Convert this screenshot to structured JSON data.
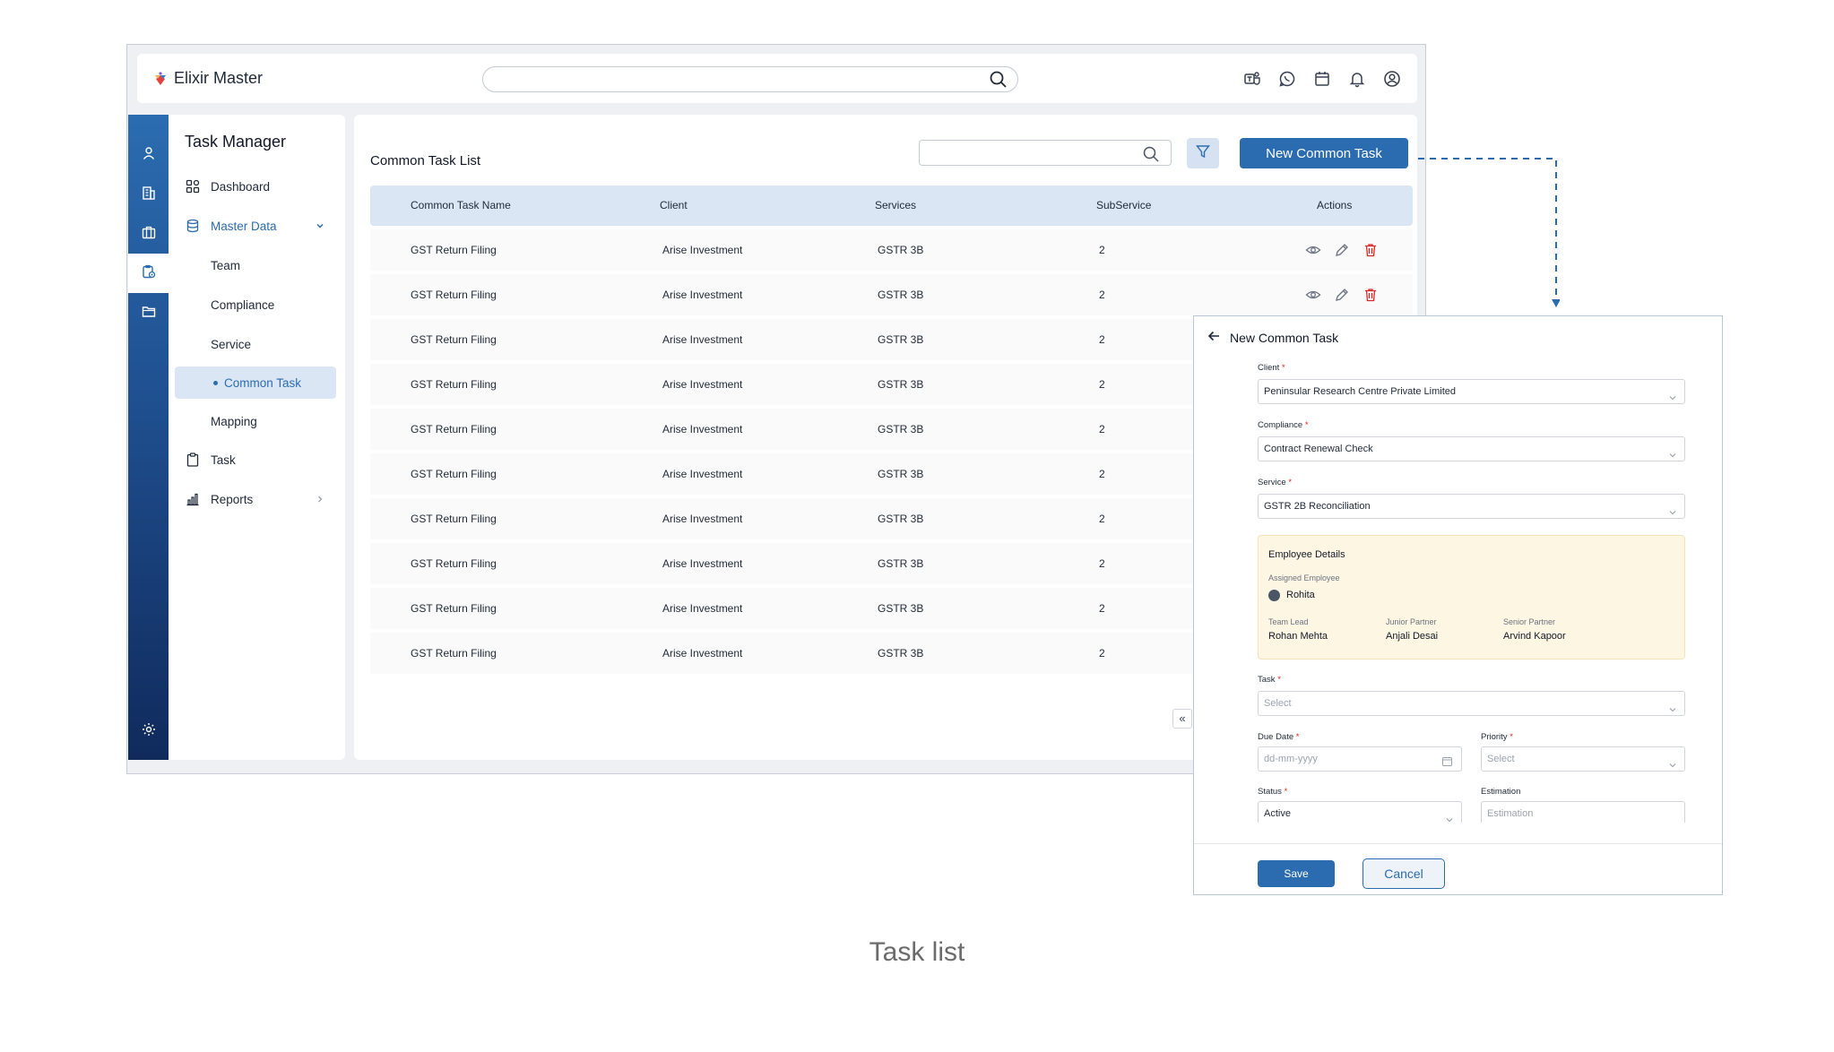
{
  "app": {
    "brand_name": "Elixir Master"
  },
  "header": {
    "search_placeholder": "",
    "icons": [
      "teams-icon",
      "whatsapp-icon",
      "calendar-icon",
      "bell-icon",
      "user-circle-icon"
    ]
  },
  "rail": {
    "icons": [
      "user-icon",
      "building-icon",
      "briefcase-icon",
      "task-settings-icon",
      "folder-icon",
      "settings-icon"
    ],
    "active_index": 3
  },
  "sidebar": {
    "title": "Task Manager",
    "items": {
      "dashboard": "Dashboard",
      "master_data": "Master Data",
      "team": "Team",
      "compliance": "Compliance",
      "service": "Service",
      "common_task": "Common Task",
      "mapping": "Mapping",
      "task": "Task",
      "reports": "Reports"
    }
  },
  "list": {
    "title": "Common Task List",
    "new_button": "New Common Task",
    "columns": [
      "Common Task Name",
      "Client",
      "Services",
      "SubService",
      "Actions"
    ],
    "rows": [
      [
        "GST Return Filing",
        "Arise Investment",
        "GSTR 3B",
        "2"
      ],
      [
        "GST Return Filing",
        "Arise Investment",
        "GSTR 3B",
        "2"
      ],
      [
        "GST Return Filing",
        "Arise Investment",
        "GSTR 3B",
        "2"
      ],
      [
        "GST Return Filing",
        "Arise Investment",
        "GSTR 3B",
        "2"
      ],
      [
        "GST Return Filing",
        "Arise Investment",
        "GSTR 3B",
        "2"
      ],
      [
        "GST Return Filing",
        "Arise Investment",
        "GSTR 3B",
        "2"
      ],
      [
        "GST Return Filing",
        "Arise Investment",
        "GSTR 3B",
        "2"
      ],
      [
        "GST Return Filing",
        "Arise Investment",
        "GSTR 3B",
        "2"
      ],
      [
        "GST Return Filing",
        "Arise Investment",
        "GSTR 3B",
        "2"
      ],
      [
        "GST Return Filing",
        "Arise Investment",
        "GSTR 3B",
        "2"
      ]
    ],
    "pager_first": "«"
  },
  "panel": {
    "title": "New Common Task",
    "client": {
      "label": "Client",
      "value": "Peninsular Research Centre Private Limited"
    },
    "compliance": {
      "label": "Compliance",
      "value": "Contract Renewal Check"
    },
    "service": {
      "label": "Service",
      "value": "GSTR 2B Reconciliation"
    },
    "employee": {
      "title": "Employee Details",
      "assigned_label": "Assigned Employee",
      "assigned_name": "Rohita",
      "team_lead_label": "Team Lead",
      "team_lead": "Rohan Mehta",
      "junior_partner_label": "Junior Partner",
      "junior_partner": "Anjali Desai",
      "senior_partner_label": "Senior Partner",
      "senior_partner": "Arvind Kapoor"
    },
    "task": {
      "label": "Task",
      "placeholder": "Select"
    },
    "due_date": {
      "label": "Due Date",
      "placeholder": "dd-mm-yyyy"
    },
    "priority": {
      "label": "Priority",
      "placeholder": "Select"
    },
    "status": {
      "label": "Status",
      "value": "Active"
    },
    "estimation": {
      "label": "Estimation",
      "placeholder": "Estimation"
    },
    "required_mark": "*",
    "save": "Save",
    "cancel": "Cancel"
  },
  "caption": "Task list",
  "colors": {
    "primary": "#2b6cb0",
    "header_row": "#dbe6f4",
    "danger": "#dc2626",
    "employee_card": "#fdf6e2"
  }
}
